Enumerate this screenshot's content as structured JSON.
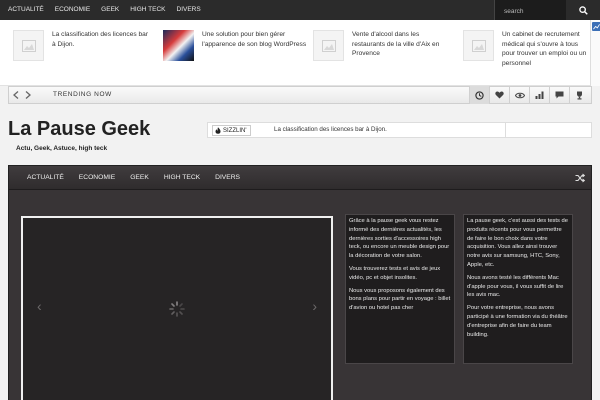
{
  "topnav": {
    "items": [
      "ACTUALITÉ",
      "ECONOMIE",
      "GEEK",
      "HIGH TECK",
      "DIVERS"
    ],
    "search_placeholder": "search"
  },
  "featured": [
    {
      "title": "La classification des licences bar à Dijon.",
      "thumb": "placeholder"
    },
    {
      "title": "Une solution pour bien gérer l'apparence de son blog WordPress",
      "thumb": "photo"
    },
    {
      "title": "Vente d'alcool dans les restaurants de la ville d'Aix en Provence",
      "thumb": "placeholder"
    },
    {
      "title": "Un cabinet de recrutement médical qui s'ouvre à tous pour trouver un emploi ou un personnel",
      "thumb": "placeholder"
    }
  ],
  "trending": {
    "label": "TRENDING NOW",
    "icons": [
      "clock-icon",
      "heart-icon",
      "eye-icon",
      "bar-chart-icon",
      "comment-icon",
      "trophy-icon"
    ]
  },
  "header": {
    "site_title": "La Pause Geek",
    "tagline": "Actu, Geek, Astuce, high teck",
    "sizzlin_label": "SIZZLIN'",
    "sizzlin_text": "La classification des licences bar à Dijon."
  },
  "mainnav": {
    "items": [
      "ACTUALITÉ",
      "ECONOMIE",
      "GEEK",
      "HIGH TECK",
      "DIVERS"
    ]
  },
  "columns": {
    "left": [
      "Grâce à la pause geek vous restez informé des dernières actualités, les dernières sorties d'accessoires high teck, ou encore un meuble design pour la décoration de votre salon.",
      "Vous trouverez tests et avis de jeux vidéo, pc et objet insolites.",
      "Nous vous proposons également des bons plans pour partir en voyage : billet d'avion ou hotel pas cher"
    ],
    "right": [
      "La pause geek, c'est aussi des tests de produits récents pour vous permettre de faire le bon choix dans votre acquisition. Vous allez ainsi trouver notre avis sur samsung, HTC, Sony, Apple, etc.",
      "Nous avons testé les différents Mac d'apple pour vous, il vous suffit de lire les avis mac.",
      "Pour votre entreprise, nous avons participé à une formation via du théâtre d'entreprise afin de faire du team building."
    ]
  },
  "colors": {
    "topbar": "#2b2b2b",
    "main_bg": "#383436",
    "accent": "#3b6fb6"
  }
}
